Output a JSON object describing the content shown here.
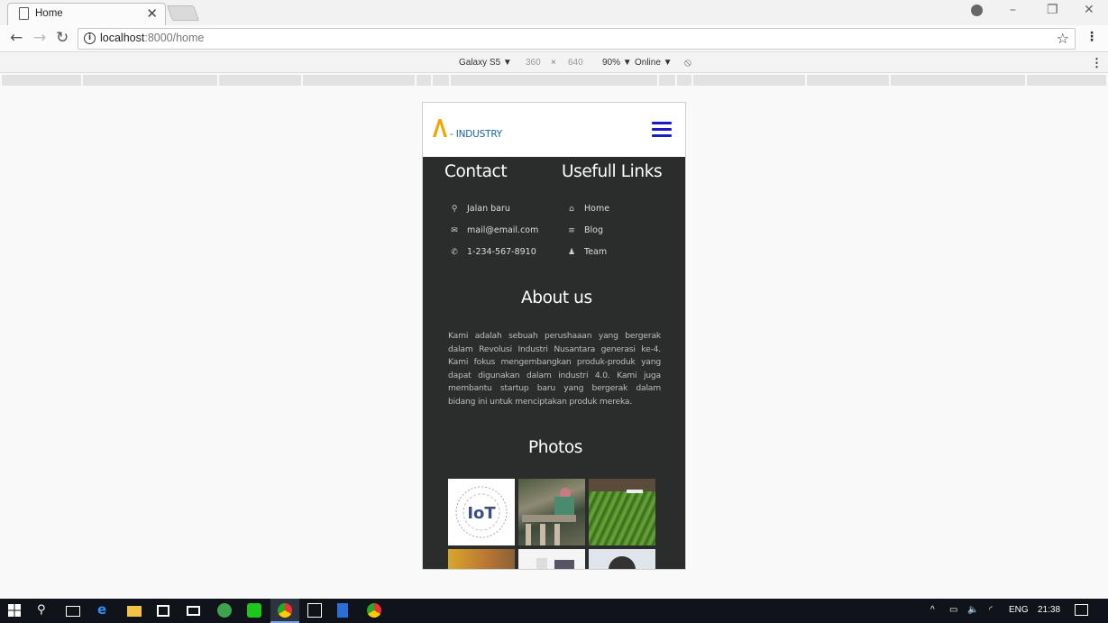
{
  "browser": {
    "tab_title": "Home",
    "tab_close": "✕",
    "url_host": "localhost",
    "url_rest": ":8000/home"
  },
  "devtools": {
    "device": "Galaxy S5 ▼",
    "width": "360",
    "times": "×",
    "height": "640",
    "zoom": "90% ▼",
    "network": "Online ▼"
  },
  "site": {
    "logo_text": "- INDUSTRY",
    "brand_color": "#f4a400",
    "accent_color": "#1a1ac8",
    "contact": {
      "heading": "Contact",
      "items": [
        {
          "icon": "map-marker-icon",
          "glyph": "⚲",
          "text": "Jalan baru"
        },
        {
          "icon": "envelope-icon",
          "glyph": "✉",
          "text": "mail@email.com"
        },
        {
          "icon": "phone-icon",
          "glyph": "✆",
          "text": "1-234-567-8910"
        }
      ]
    },
    "links": {
      "heading": "Usefull Links",
      "items": [
        {
          "icon": "home-icon",
          "glyph": "⌂",
          "text": "Home"
        },
        {
          "icon": "list-icon",
          "glyph": "≡",
          "text": "Blog"
        },
        {
          "icon": "user-icon",
          "glyph": "♟",
          "text": "Team"
        }
      ]
    },
    "about": {
      "heading": "About us",
      "text": "Kami adalah sebuah perushaaan yang bergerak dalam Revolusi Industri Nusantara generasi ke-4. Kami fokus mengembangkan produk-produk yang dapat digunakan dalam industri 4.0. Kami juga membantu startup baru yang bergerak dalam bidang ini untuk menciptakan produk mereka."
    },
    "photos": {
      "heading": "Photos",
      "iot_label": "IoT"
    }
  },
  "taskbar": {
    "lang": "ENG",
    "time": "21:38"
  }
}
